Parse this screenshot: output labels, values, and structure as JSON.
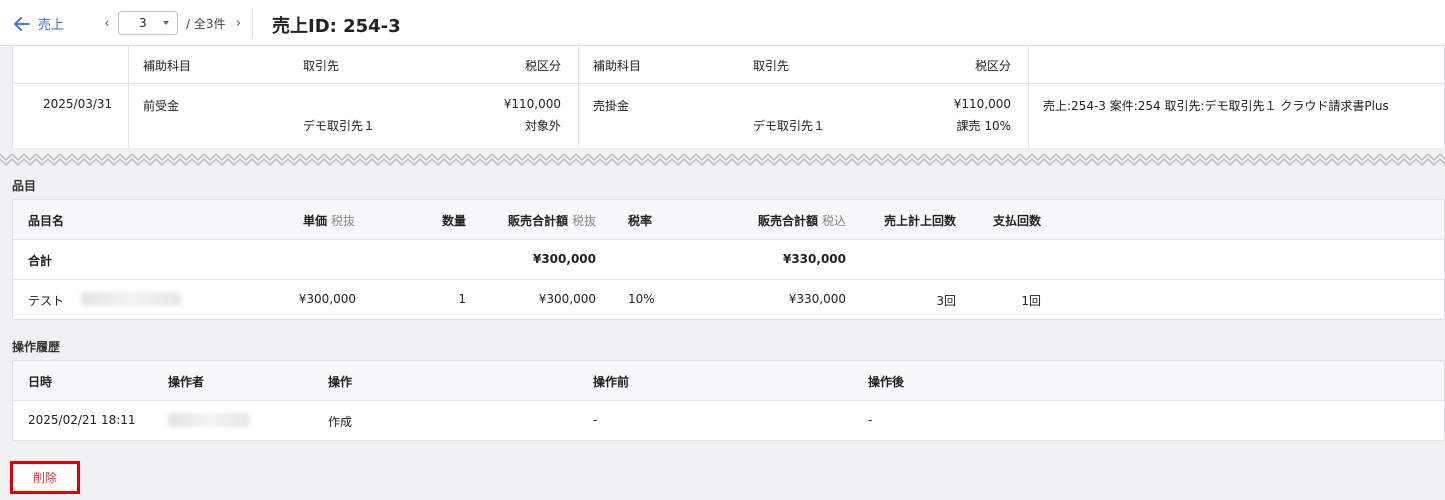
{
  "header": {
    "back_label": "売上",
    "page_value": "3",
    "page_total": "/ 全3件",
    "prev": "‹",
    "next": "›",
    "title": "売上ID: 254-3"
  },
  "journal": {
    "headers_left": {
      "sub_account": "補助科目",
      "partner": "取引先",
      "tax_class": "税区分"
    },
    "headers_right": {
      "sub_account": "補助科目",
      "partner": "取引先",
      "tax_class": "税区分"
    },
    "row": {
      "date": "2025/03/31",
      "debit_account": "前受金",
      "debit_amount": "¥110,000",
      "debit_partner": "デモ取引先１",
      "debit_tax": "対象外",
      "credit_account": "売掛金",
      "credit_amount": "¥110,000",
      "credit_partner": "デモ取引先１",
      "credit_tax": "課売 10%",
      "memo": "売上:254-3 案件:254 取引先:デモ取引先１ クラウド請求書Plus"
    }
  },
  "items": {
    "section_title": "品目",
    "headers": {
      "name": "品目名",
      "unit_price": "単価",
      "unit_price_sub": "税抜",
      "qty": "数量",
      "sales_total": "販売合計額",
      "sales_total_sub": "税抜",
      "tax_rate": "税率",
      "sales_total_incl": "販売合計額",
      "sales_total_incl_sub": "税込",
      "sales_count": "売上計上回数",
      "payment_count": "支払回数"
    },
    "total_row": {
      "label": "合計",
      "sales_total": "¥300,000",
      "sales_total_incl": "¥330,000"
    },
    "rows": [
      {
        "name": "テスト",
        "unit_price": "¥300,000",
        "qty": "1",
        "sales_total": "¥300,000",
        "tax_rate": "10%",
        "sales_total_incl": "¥330,000",
        "sales_count": "3回",
        "payment_count": "1回"
      }
    ]
  },
  "history": {
    "section_title": "操作履歴",
    "headers": {
      "datetime": "日時",
      "operator": "操作者",
      "action": "操作",
      "before": "操作前",
      "after": "操作後"
    },
    "rows": [
      {
        "datetime": "2025/02/21 18:11",
        "action": "作成",
        "before": "-",
        "after": "-"
      }
    ]
  },
  "footer": {
    "delete_label": "削除"
  },
  "colors": {
    "accent": "#2f6fd6",
    "danger": "#e00000",
    "background": "#f0f1f3"
  }
}
